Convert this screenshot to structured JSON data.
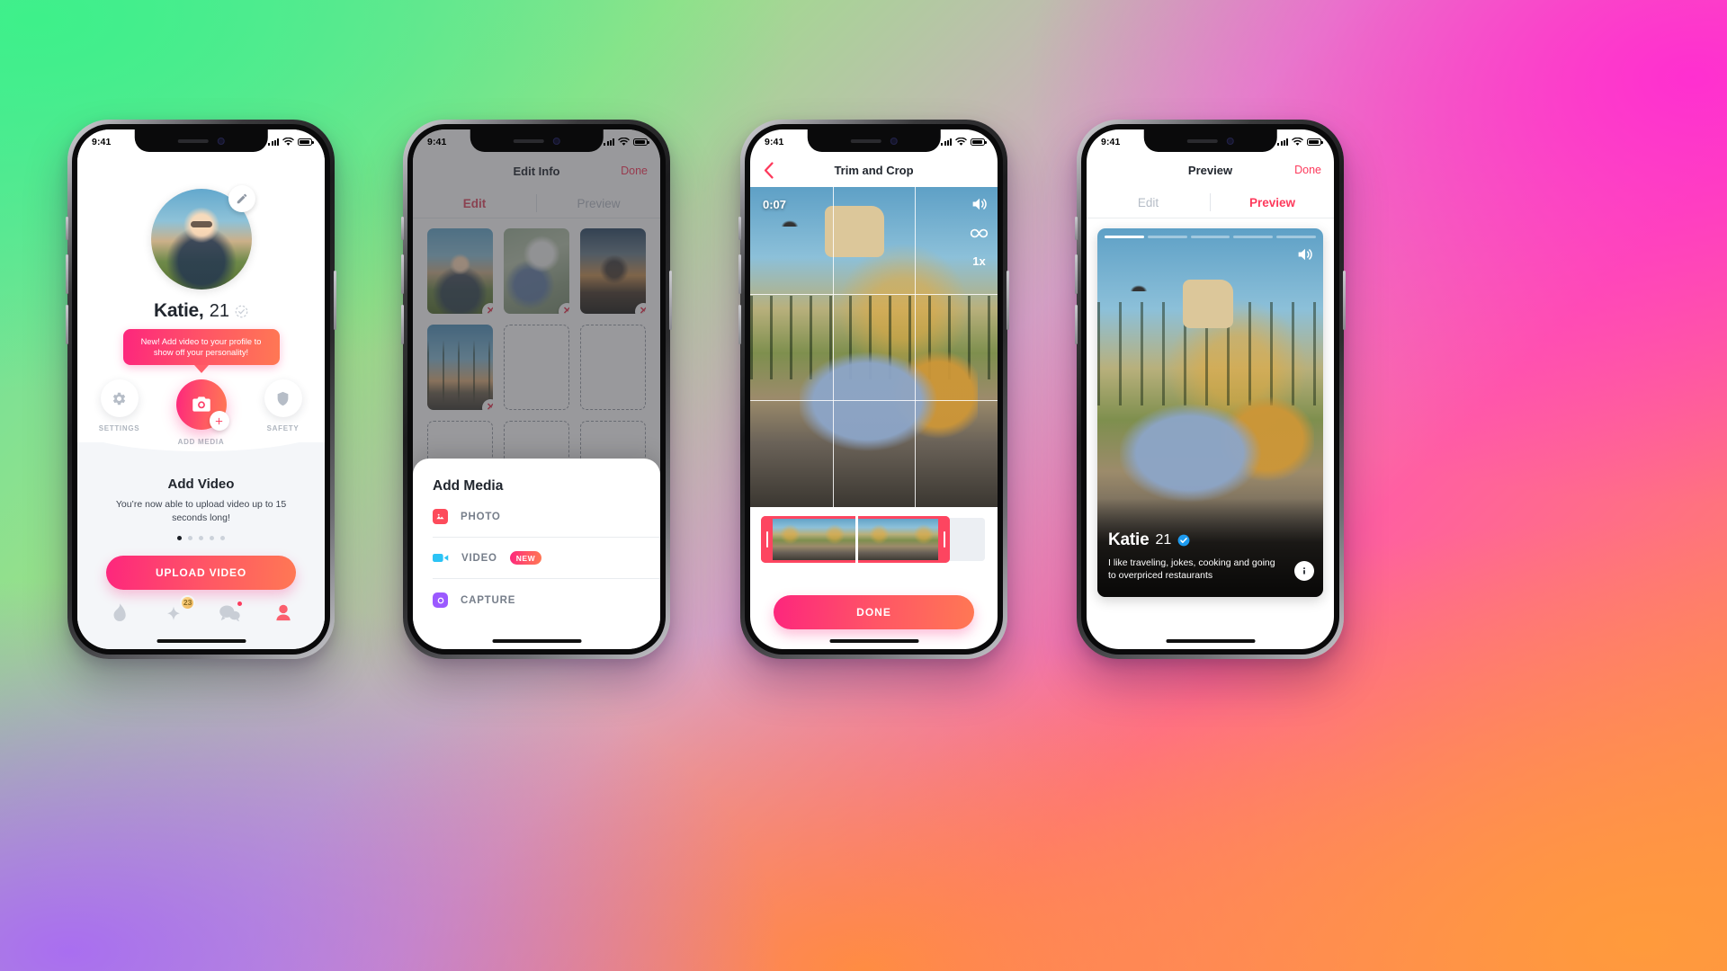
{
  "status_bar": {
    "time": "9:41",
    "signal_icon": "cellular-bars-icon",
    "wifi_icon": "wifi-icon",
    "battery_icon": "battery-icon"
  },
  "brand": {
    "gradient_start": "#fd267d",
    "gradient_end": "#ff7854",
    "accent_red": "#fd3a5c",
    "muted_gray": "#9aa0a8",
    "verified_blue": "#1d9bf0"
  },
  "phone1": {
    "name": "Katie",
    "age": "21",
    "name_separator": ",",
    "edit_avatar_icon": "pencil-icon",
    "completeness_icon": "progress-check-icon",
    "tooltip": "New! Add video to your profile to show off your personality!",
    "actions": [
      {
        "label": "SETTINGS",
        "icon": "gear-icon"
      },
      {
        "label": "ADD MEDIA",
        "icon": "camera-plus-icon"
      },
      {
        "label": "SAFETY",
        "icon": "shield-icon"
      }
    ],
    "card": {
      "title": "Add Video",
      "subtitle": "You’re now able to upload video up to 15 seconds long!",
      "dots_total": 5,
      "dots_active_index": 0,
      "cta": "UPLOAD VIDEO"
    },
    "tabbar": [
      {
        "name": "flame-icon",
        "badge": ""
      },
      {
        "name": "star-icon",
        "badge": "23"
      },
      {
        "name": "chat-icon",
        "badge": "dot"
      },
      {
        "name": "profile-icon",
        "badge": ""
      }
    ]
  },
  "phone2": {
    "nav_title": "Edit Info",
    "done": "Done",
    "tabs": [
      {
        "label": "Edit",
        "active": true
      },
      {
        "label": "Preview",
        "active": false
      }
    ],
    "grid": [
      {
        "kind": "photo",
        "art": "portrait",
        "action": "remove"
      },
      {
        "kind": "photo",
        "art": "green",
        "action": "remove"
      },
      {
        "kind": "photo",
        "art": "street",
        "action": "remove"
      },
      {
        "kind": "photo",
        "art": "palms",
        "action": "remove"
      },
      {
        "kind": "empty",
        "action": "none"
      },
      {
        "kind": "empty",
        "action": "none"
      },
      {
        "kind": "empty",
        "action": "none"
      },
      {
        "kind": "empty",
        "action": "add"
      },
      {
        "kind": "empty",
        "action": "add"
      }
    ],
    "sheet": {
      "title": "Add Media",
      "items": [
        {
          "label": "PHOTO",
          "icon": "image-icon",
          "badge": "",
          "color": "#fd4b5b"
        },
        {
          "label": "VIDEO",
          "icon": "video-camera-icon",
          "badge": "NEW",
          "color": "#2bc3f5"
        },
        {
          "label": "CAPTURE",
          "icon": "capture-icon",
          "badge": "",
          "color": "#9b59ff"
        }
      ]
    }
  },
  "phone3": {
    "back_icon": "chevron-left-icon",
    "nav_title": "Trim and Crop",
    "timecode": "0:07",
    "controls": [
      {
        "name": "volume-icon",
        "label": ""
      },
      {
        "name": "loop-icon",
        "label": ""
      },
      {
        "name": "speed-icon",
        "label": "1x"
      }
    ],
    "grid_overlay": true,
    "timeline": {
      "frames": 5,
      "handle_left": "trim-handle-left",
      "handle_right": "trim-handle-right"
    },
    "cta": "DONE"
  },
  "phone4": {
    "nav_title": "Preview",
    "done": "Done",
    "tabs": [
      {
        "label": "Edit",
        "active": false
      },
      {
        "label": "Preview",
        "active": true
      }
    ],
    "progress_segments": 5,
    "progress_active_index": 0,
    "volume_icon": "volume-icon",
    "info_icon": "info-icon",
    "verified_icon": "verified-badge-icon",
    "name": "Katie",
    "age": "21",
    "bio": "I like traveling, jokes, cooking and going to overpriced restaurants"
  }
}
